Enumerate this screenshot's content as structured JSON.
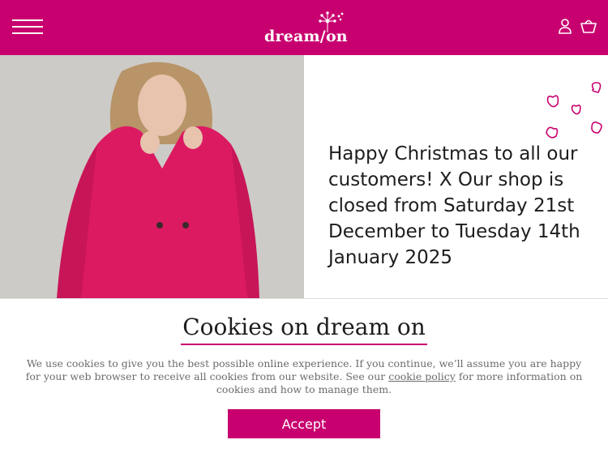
{
  "header": {
    "logo_text": "dream/on",
    "colors": {
      "brand": "#c8006f",
      "text": "#ffffff"
    },
    "icons": [
      "menu-icon",
      "account-icon",
      "basket-icon"
    ]
  },
  "hero": {
    "message": "Happy Christmas to all our customers! X Our shop is closed from Saturday 21st December to Tuesday 14th January 2025"
  },
  "cookie_banner": {
    "title": "Cookies on dream on",
    "text_before": "We use cookies to give you the best possible online experience. If you continue, we’ll assume you are happy for your web browser to receive all cookies from our website. See our",
    "link_text": "cookie policy",
    "text_after": "for more information on cookies and how to manage them.",
    "accept_label": "Accept"
  }
}
